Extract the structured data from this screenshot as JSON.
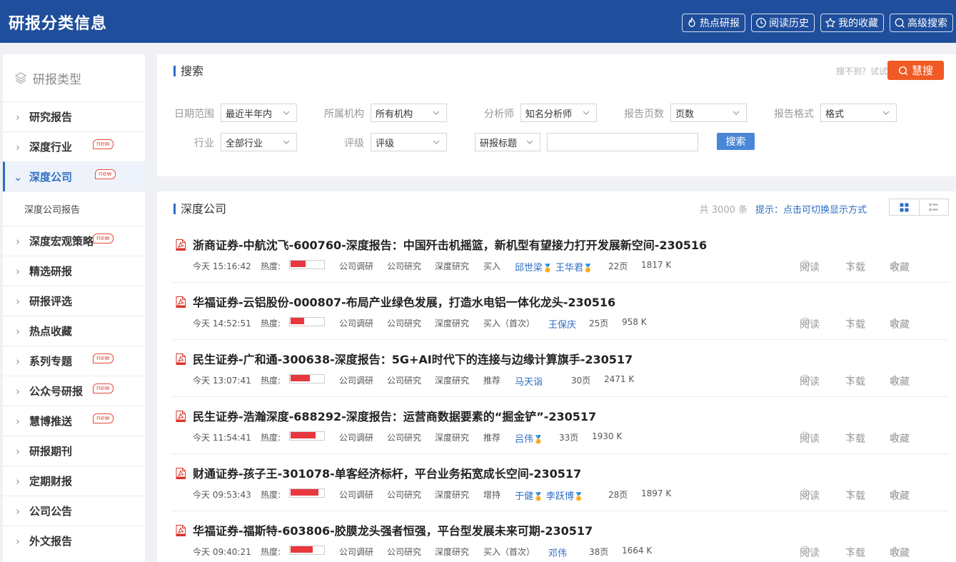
{
  "header": {
    "title": "研报分类信息",
    "buttons": [
      {
        "label": "热点研报",
        "icon": "flame-icon"
      },
      {
        "label": "阅读历史",
        "icon": "clock-icon"
      },
      {
        "label": "我的收藏",
        "icon": "star-icon"
      },
      {
        "label": "高级搜索",
        "icon": "search-icon"
      }
    ]
  },
  "sidebar": {
    "title": "研报类型",
    "items": [
      {
        "label": "研究报告",
        "new": false
      },
      {
        "label": "深度行业",
        "new": true,
        "badge": "new"
      },
      {
        "label": "深度公司",
        "new": true,
        "badge": "new",
        "active": true,
        "sub": "深度公司报告"
      },
      {
        "label": "深度宏观策略",
        "new": true,
        "badge": "new"
      },
      {
        "label": "精选研报",
        "new": false
      },
      {
        "label": "研报评选",
        "new": false
      },
      {
        "label": "热点收藏",
        "new": false
      },
      {
        "label": "系列专题",
        "new": true,
        "badge": "new"
      },
      {
        "label": "公众号研报",
        "new": true,
        "badge": "new"
      },
      {
        "label": "慧博推送",
        "new": true,
        "badge": "new"
      },
      {
        "label": "研报期刊",
        "new": false
      },
      {
        "label": "定期财报",
        "new": false
      },
      {
        "label": "公司公告",
        "new": false
      },
      {
        "label": "外文报告",
        "new": false
      }
    ]
  },
  "search": {
    "title": "搜索",
    "hint": "搜不到？试试",
    "huisou_label": "慧搜",
    "filters": {
      "date_label": "日期范围",
      "date_value": "最近半年内",
      "org_label": "所属机构",
      "org_value": "所有机构",
      "analyst_label": "分析师",
      "analyst_value": "知名分析师",
      "pages_label": "报告页数",
      "pages_value": "页数",
      "format_label": "报告格式",
      "format_value": "格式",
      "industry_label": "行业",
      "industry_value": "全部行业",
      "rating_label": "评级",
      "rating_value": "评级",
      "field_value": "研报标题",
      "keyword_value": "",
      "search_button": "搜索"
    }
  },
  "list": {
    "title": "深度公司",
    "count": "共 3000 条",
    "tip": "提示：点击可切换显示方式",
    "action_read": "阅读",
    "action_download": "下载",
    "action_fav": "收藏",
    "heat_label": "热度:",
    "rows": [
      {
        "title": "浙商证券-中航沈飞-600760-深度报告：中国歼击机摇篮，新机型有望接力打开发展新空间-230516",
        "time": "今天 15:16:42",
        "heat": 0.45,
        "tags": [
          "公司调研",
          "公司研究",
          "深度研究"
        ],
        "rating": "买入",
        "analysts": [
          {
            "name": "邱世梁",
            "medal": true
          },
          {
            "name": "王华君",
            "medal": true
          }
        ],
        "pages": "22页",
        "size": "1817 K"
      },
      {
        "title": "华福证券-云铝股份-000807-布局产业绿色发展，打造水电铝一体化龙头-230516",
        "time": "今天 14:52:51",
        "heat": 0.42,
        "tags": [
          "公司调研",
          "公司研究",
          "深度研究"
        ],
        "rating": "买入（首次）",
        "analysts": [
          {
            "name": "王保庆",
            "medal": false
          }
        ],
        "pages": "25页",
        "size": "958 K"
      },
      {
        "title": "民生证券-广和通-300638-深度报告：5G+AI时代下的连接与边缘计算旗手-230517",
        "time": "今天 13:07:41",
        "heat": 0.58,
        "tags": [
          "公司调研",
          "公司研究",
          "深度研究"
        ],
        "rating": "推荐",
        "analysts": [
          {
            "name": "马天诣",
            "medal": false
          }
        ],
        "pages": "30页",
        "size": "2471 K"
      },
      {
        "title": "民生证券-浩瀚深度-688292-深度报告：运营商数据要素的“掘金铲”-230517",
        "time": "今天 11:54:41",
        "heat": 0.75,
        "tags": [
          "公司调研",
          "公司研究",
          "深度研究"
        ],
        "rating": "推荐",
        "analysts": [
          {
            "name": "吕伟",
            "medal": true
          }
        ],
        "pages": "33页",
        "size": "1930 K"
      },
      {
        "title": "财通证券-孩子王-301078-单客经济标杆，平台业务拓宽成长空间-230517",
        "time": "今天 09:53:43",
        "heat": 0.85,
        "tags": [
          "公司调研",
          "公司研究",
          "深度研究"
        ],
        "rating": "增持",
        "analysts": [
          {
            "name": "于健",
            "medal": true
          },
          {
            "name": "李跃博",
            "medal": true
          }
        ],
        "pages": "28页",
        "size": "1897 K"
      },
      {
        "title": "华福证券-福斯特-603806-胶膜龙头强者恒强，平台型发展未来可期-230517",
        "time": "今天 09:40:21",
        "heat": 0.68,
        "tags": [
          "公司调研",
          "公司研究",
          "深度研究"
        ],
        "rating": "买入（首次）",
        "analysts": [
          {
            "name": "邓伟",
            "medal": false
          }
        ],
        "pages": "38页",
        "size": "1664 K"
      }
    ]
  },
  "colors": {
    "brand": "#1f4e9c",
    "accent": "#2e6cc4",
    "huisou": "#f05a24",
    "heat": "#e8373e"
  }
}
